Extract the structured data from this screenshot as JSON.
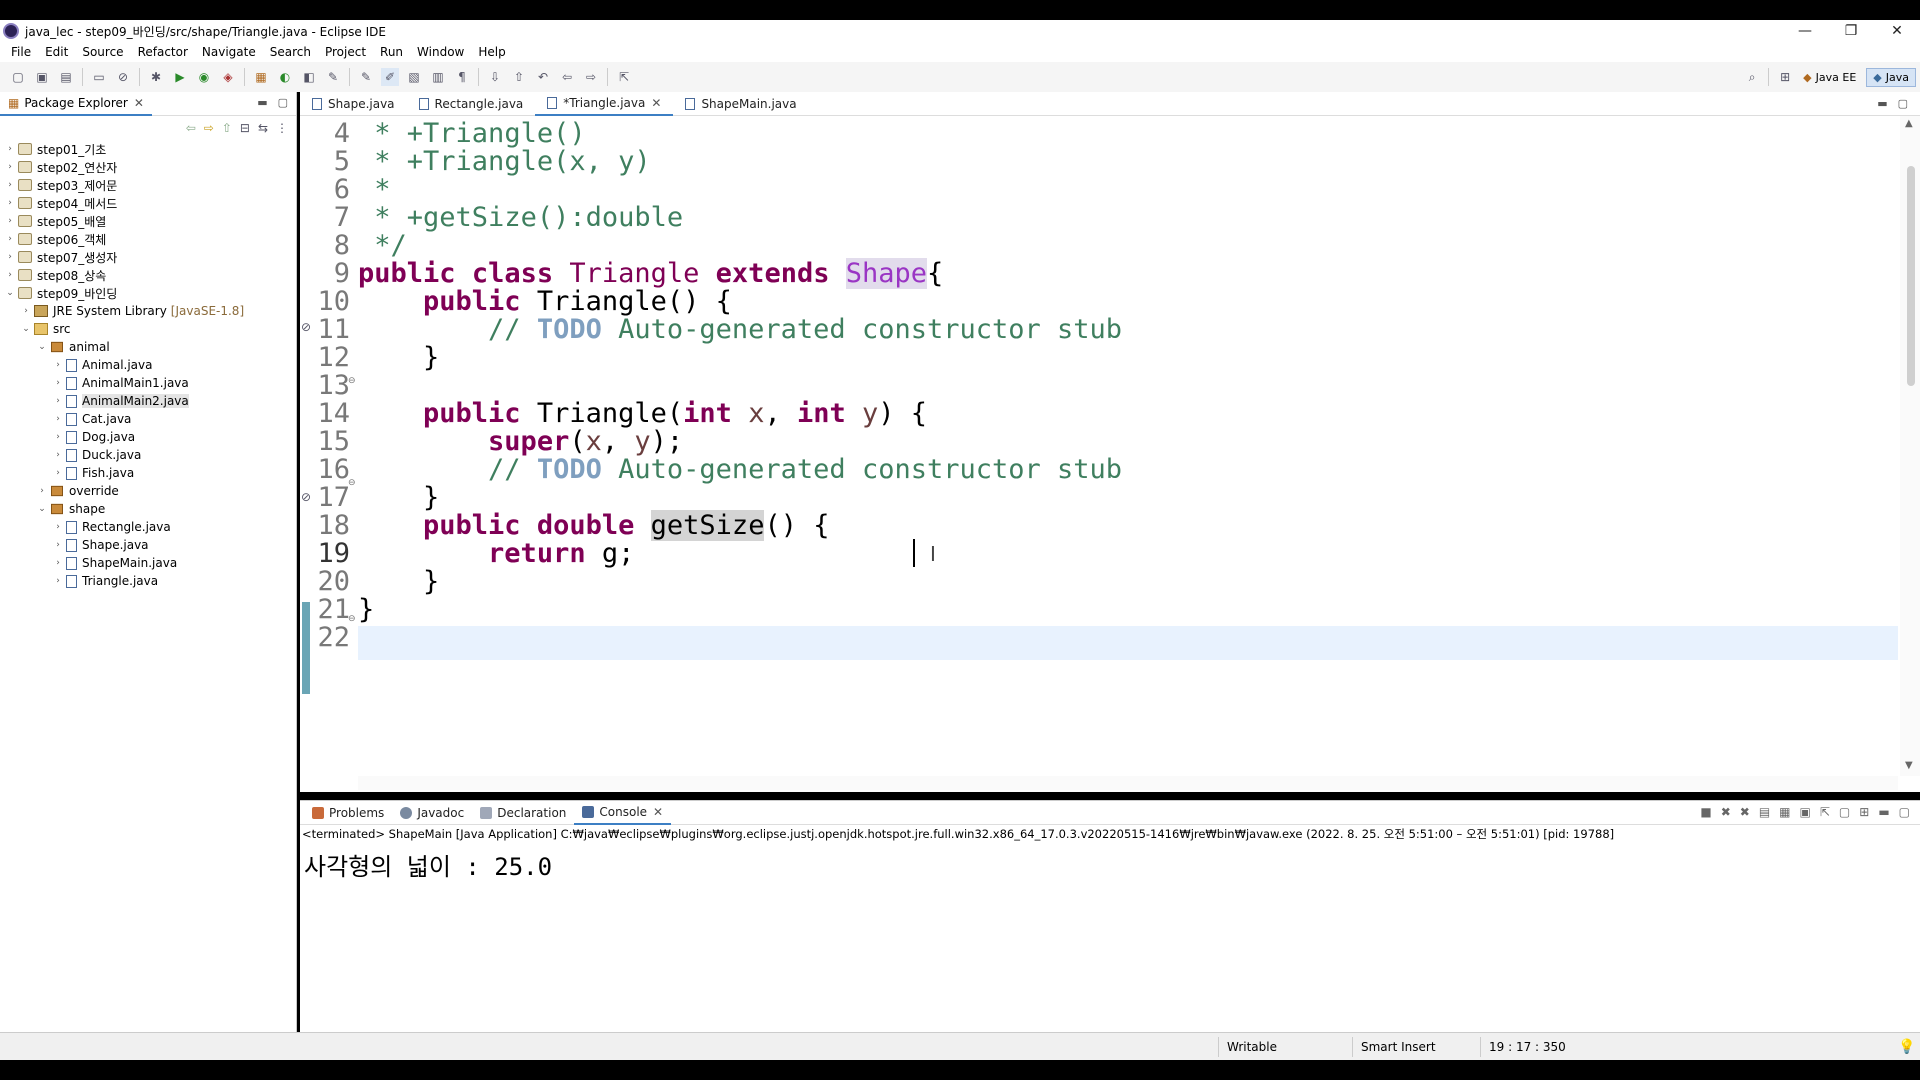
{
  "window": {
    "title": "java_lec - step09_바인딩/src/shape/Triangle.java - Eclipse IDE"
  },
  "menu": [
    "File",
    "Edit",
    "Source",
    "Refactor",
    "Navigate",
    "Search",
    "Project",
    "Run",
    "Window",
    "Help"
  ],
  "perspectives": {
    "java_ee": "Java EE",
    "java": "Java"
  },
  "explorer": {
    "title": "Package Explorer",
    "items": [
      {
        "label": "step01_기초"
      },
      {
        "label": "step02_연산자"
      },
      {
        "label": "step03_제어문"
      },
      {
        "label": "step04_메서드"
      },
      {
        "label": "step05_배열"
      },
      {
        "label": "step06_객체"
      },
      {
        "label": "step07_생성자"
      },
      {
        "label": "step08_상속"
      },
      {
        "label": "step09_바인딩"
      },
      {
        "label": "JRE System Library",
        "extra": "[JavaSE-1.8]"
      },
      {
        "label": "src"
      },
      {
        "label": "animal"
      },
      {
        "label": "Animal.java"
      },
      {
        "label": "AnimalMain1.java"
      },
      {
        "label": "AnimalMain2.java"
      },
      {
        "label": "Cat.java"
      },
      {
        "label": "Dog.java"
      },
      {
        "label": "Duck.java"
      },
      {
        "label": "Fish.java"
      },
      {
        "label": "override"
      },
      {
        "label": "shape"
      },
      {
        "label": "Rectangle.java"
      },
      {
        "label": "Shape.java"
      },
      {
        "label": "ShapeMain.java"
      },
      {
        "label": "Triangle.java"
      }
    ]
  },
  "editor": {
    "tabs": [
      "Shape.java",
      "Rectangle.java",
      "*Triangle.java",
      "ShapeMain.java"
    ],
    "line_numbers": [
      "4",
      "5",
      "6",
      "7",
      "8",
      "9",
      "10",
      "11",
      "12",
      "13",
      "14",
      "15",
      "16",
      "17",
      "18",
      "19",
      "20",
      "21",
      "22"
    ],
    "lines": {
      "l4": "+Triangle()",
      "l5": "+Triangle(x, y)",
      "l7": "+getSize():double",
      "l11_todo": "TODO",
      "l11_text": " Auto-generated constructor stub",
      "l16_todo": "TODO",
      "l16_text": " Auto-generated constructor stub",
      "l19_value": "g"
    }
  },
  "console": {
    "tabs": [
      "Problems",
      "Javadoc",
      "Declaration",
      "Console"
    ],
    "description": "<terminated> ShapeMain [Java Application] C:₩java₩eclipse₩plugins₩org.eclipse.justj.openjdk.hotspot.jre.full.win32.x86_64_17.0.3.v20220515-1416₩jre₩bin₩javaw.exe  (2022. 8. 25. 오전 5:51:00 – 오전 5:51:01) [pid: 19788]",
    "output": "사각형의 넓이 : 25.0"
  },
  "status": {
    "writable": "Writable",
    "insert_mode": "Smart Insert",
    "position": "19 : 17 : 350"
  }
}
